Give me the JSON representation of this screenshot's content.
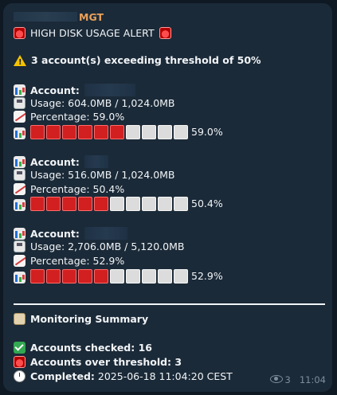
{
  "message": {
    "sender_suffix": "MGT",
    "title": "HIGH DISK USAGE ALERT",
    "warning": "3 account(s) exceeding threshold of 50%",
    "accounts": [
      {
        "account_label": "Account:",
        "usage": "Usage: 604.0MB / 1,024.0MB",
        "percentage": "Percentage: 59.0%",
        "bar_filled": 6,
        "bar_total": 10,
        "bar_pct": "59.0%"
      },
      {
        "account_label": "Account:",
        "usage": "Usage: 516.0MB / 1,024.0MB",
        "percentage": "Percentage: 50.4%",
        "bar_filled": 5,
        "bar_total": 10,
        "bar_pct": "50.4%"
      },
      {
        "account_label": "Account:",
        "usage": "Usage: 2,706.0MB / 5,120.0MB",
        "percentage": "Percentage: 52.9%",
        "bar_filled": 5,
        "bar_total": 10,
        "bar_pct": "52.9%"
      }
    ],
    "summary_title": "Monitoring Summary",
    "checked": "Accounts checked: 16",
    "over": "Accounts over threshold: 3",
    "completed_label": "Completed:",
    "completed_value": "2025-06-18 11:04:20 CEST",
    "views": "3",
    "time": "11:04"
  },
  "icons": [
    "siren-icon",
    "warning-icon",
    "chart-icon",
    "disk-icon",
    "trend-icon",
    "clipboard-icon",
    "check-icon",
    "clock-icon",
    "eye-icon"
  ],
  "colors": {
    "bar_filled": "#d21f1f",
    "bar_empty": "#dcdcdc",
    "sender": "#e9a15a",
    "background": "#1b2a38"
  }
}
